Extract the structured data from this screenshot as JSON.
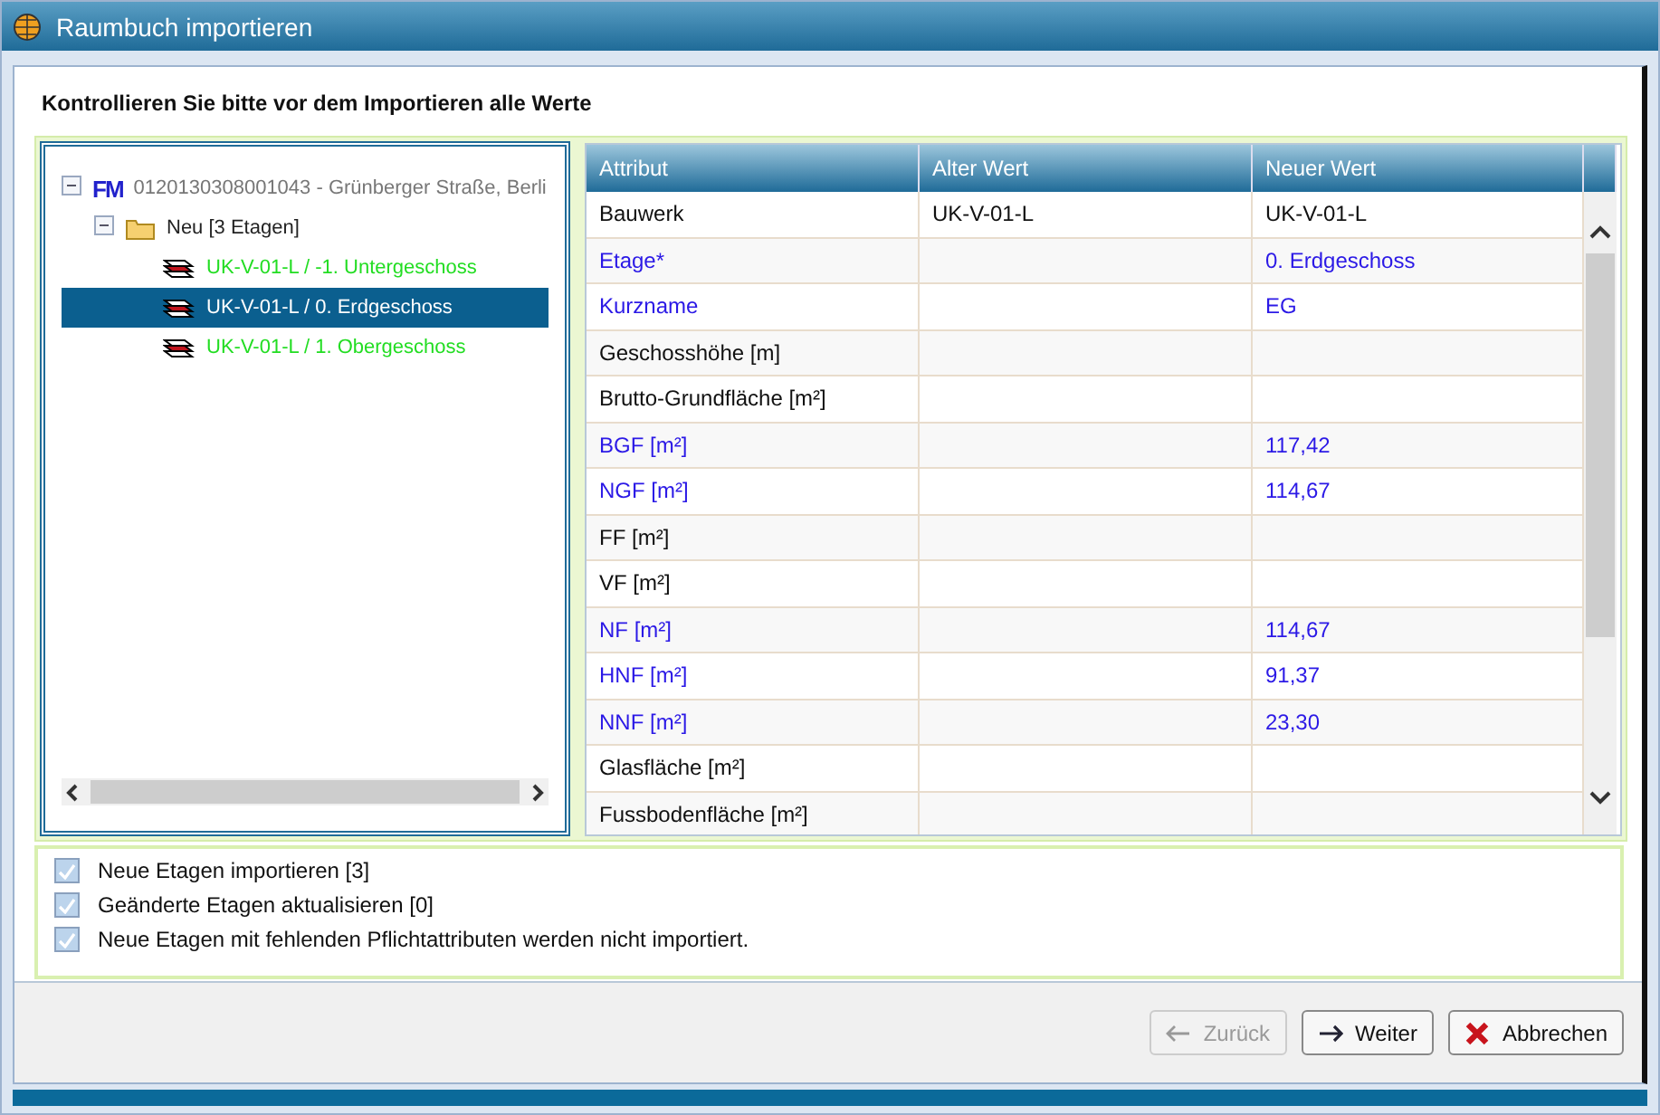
{
  "window": {
    "title": "Raumbuch importieren"
  },
  "heading": "Kontrollieren Sie bitte vor dem Importieren alle Werte",
  "tree": {
    "badge": "FM",
    "label": "0120130308001043 - Grünberger Straße, Berli",
    "expanded": true,
    "children": [
      {
        "label": "Neu [3 Etagen]",
        "expanded": true,
        "children": [
          {
            "label": "UK-V-01-L / -1. Untergeschoss",
            "selected": false,
            "color": "#22dd22"
          },
          {
            "label": "UK-V-01-L / 0. Erdgeschoss",
            "selected": true
          },
          {
            "label": "UK-V-01-L / 1. Obergeschoss",
            "selected": false,
            "color": "#22dd22"
          }
        ]
      }
    ]
  },
  "table": {
    "columns": [
      "Attribut",
      "Alter Wert",
      "Neuer Wert"
    ],
    "rows": [
      {
        "attribute": "Bauwerk",
        "old": "UK-V-01-L",
        "new": "UK-V-01-L",
        "changed": false
      },
      {
        "attribute": "Etage*",
        "new": "0. Erdgeschoss",
        "changed": true
      },
      {
        "attribute": "Kurzname",
        "new": "EG",
        "changed": true
      },
      {
        "attribute": "Geschosshöhe [m]",
        "changed": false
      },
      {
        "attribute": "Brutto-Grundfläche [m²]",
        "changed": false
      },
      {
        "attribute": "BGF [m²]",
        "new": "117,42",
        "changed": true
      },
      {
        "attribute": "NGF [m²]",
        "new": "114,67",
        "changed": true
      },
      {
        "attribute": "FF [m²]",
        "changed": false
      },
      {
        "attribute": "VF [m²]",
        "changed": false
      },
      {
        "attribute": "NF [m²]",
        "new": "114,67",
        "changed": true
      },
      {
        "attribute": "HNF [m²]",
        "new": "91,37",
        "changed": true
      },
      {
        "attribute": "NNF [m²]",
        "new": "23,30",
        "changed": true
      },
      {
        "attribute": "Glasfläche [m²]",
        "changed": false
      },
      {
        "attribute": "Fussbodenfläche [m²]",
        "changed": false
      }
    ]
  },
  "options": [
    {
      "label": "Neue Etagen importieren [3]",
      "checked": true
    },
    {
      "label": "Geänderte Etagen aktualisieren [0]",
      "checked": true
    },
    {
      "label": "Neue Etagen mit fehlenden Pflichtattributen werden nicht importiert.",
      "checked": true
    }
  ],
  "buttons": [
    {
      "kind": "back",
      "label": "Zurück",
      "disabled": true
    },
    {
      "kind": "next",
      "label": "Weiter",
      "disabled": false
    },
    {
      "kind": "cancel",
      "label": "Abbrechen",
      "disabled": false
    }
  ]
}
